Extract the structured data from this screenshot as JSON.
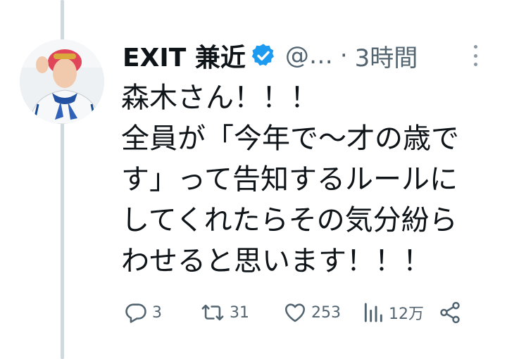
{
  "tweet": {
    "author_name": "EXIT 兼近",
    "handle": "@…",
    "separator": "·",
    "time": "3時間",
    "text_lines": [
      "森木さん！！！",
      "全員が「今年で〜才の歳で",
      "す」って告知するルールに",
      "してくれたらその気分紛ら",
      "わせると思います！！！"
    ]
  },
  "actions": {
    "replies": "3",
    "retweets": "31",
    "likes": "253",
    "views": "12万"
  },
  "icons": {
    "verified": "verified-badge-icon",
    "more": "more-vertical-icon",
    "reply": "reply-icon",
    "retweet": "retweet-icon",
    "like": "heart-icon",
    "views": "views-chart-icon",
    "share": "share-icon"
  },
  "colors": {
    "verified_blue": "#1d9bf0",
    "muted_text": "#536471",
    "thread_line": "#cfd9de"
  }
}
